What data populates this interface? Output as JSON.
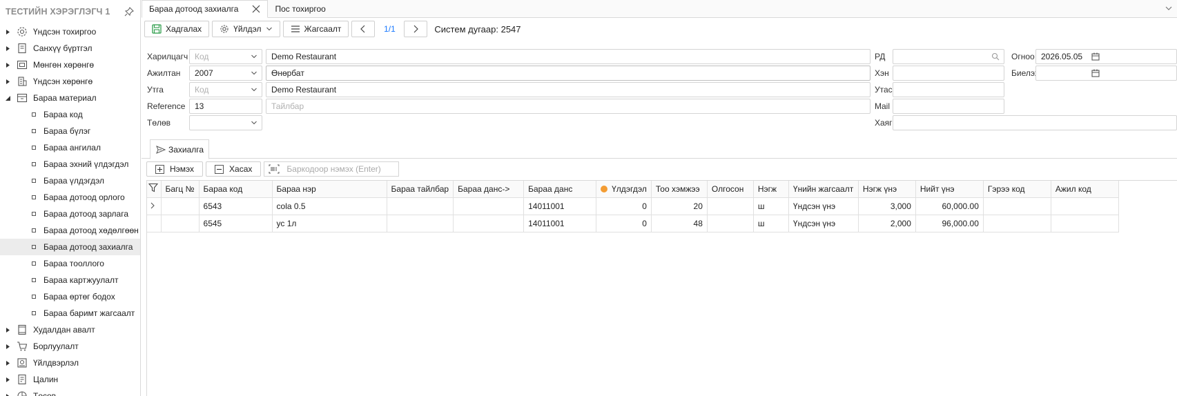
{
  "sidebar": {
    "title": "ТЕСТИЙН ХЭРЭГЛЭГЧ 1",
    "items": [
      {
        "label": "Үндсэн тохиргоо",
        "icon": "gear-icon",
        "expanded": false
      },
      {
        "label": "Санхүү бүртгэл",
        "icon": "document-icon",
        "expanded": false
      },
      {
        "label": "Мөнгөн хөрөнгө",
        "icon": "cash-icon",
        "expanded": false
      },
      {
        "label": "Үндсэн хөрөнгө",
        "icon": "building-icon",
        "expanded": false
      },
      {
        "label": "Бараа материал",
        "icon": "box-icon",
        "expanded": true
      }
    ],
    "subitems": [
      "Бараа код",
      "Бараа бүлэг",
      "Бараа ангилал",
      "Бараа эхний үлдэгдэл",
      "Бараа үлдэгдэл",
      "Бараа дотоод орлого",
      "Бараа дотоод зарлага",
      "Бараа дотоод хөдөлгөөн",
      "Бараа дотоод захиалга",
      "Бараа тооллого",
      "Бараа картжуулалт",
      "Бараа өртөг бодох",
      "Бараа баримт жагсаалт"
    ],
    "selected_subitem": "Бараа дотоод захиалга",
    "items_after": [
      {
        "label": "Худалдан авалт",
        "icon": "purchase-icon"
      },
      {
        "label": "Борлуулалт",
        "icon": "cart-icon"
      },
      {
        "label": "Үйлдвэрлэл",
        "icon": "factory-icon"
      },
      {
        "label": "Цалин",
        "icon": "payroll-icon"
      },
      {
        "label": "Төсөв",
        "icon": "pie-icon"
      }
    ]
  },
  "tabs": [
    {
      "label": "Бараа дотоод захиалга",
      "active": true
    },
    {
      "label": "Пос тохиргоо",
      "active": false
    }
  ],
  "toolbar": {
    "save_label": "Хадгалах",
    "action_label": "Үйлдэл",
    "list_label": "Жагсаалт",
    "pager": "1/1",
    "system_no": "Систем дугаар: 2547"
  },
  "form": {
    "customer_label": "Харилцагч",
    "customer_code_ph": "Код",
    "customer_name": "Demo Restaurant",
    "employee_label": "Ажилтан",
    "employee_code": "2007",
    "employee_name": "Өнөрбат",
    "warehouse_label": "Утга",
    "warehouse_code_ph": "Код",
    "warehouse_name": "Demo Restaurant",
    "reference_label": "Reference",
    "reference_value": "13",
    "description_ph": "Тайлбар",
    "status_label": "Төлөв",
    "rd_label": "РД",
    "who_label": "Хэн",
    "phone_label": "Утас",
    "mail_label": "Mail",
    "address_label": "Хаяг",
    "date_label": "Огноо",
    "date_value": "2026.05.05",
    "fulfill_label": "Биелэх"
  },
  "subtab": {
    "label": "Захиалга"
  },
  "gridbar": {
    "add_label": "Нэмэх",
    "remove_label": "Хасах",
    "barcode_ph": "Баркодоор нэмэх (Enter)"
  },
  "grid": {
    "columns": [
      "Багц №",
      "Бараа код",
      "Бараа нэр",
      "Бараа тайлбар",
      "Бараа данс->",
      "Бараа данс",
      "Үлдэгдэл",
      "Тоо хэмжээ",
      "Олгосон",
      "Нэгж",
      "Үнийн жагсаалт",
      "Нэгж үнэ",
      "Нийт үнэ",
      "Гэрээ код",
      "Ажил код"
    ],
    "rows": [
      [
        "",
        "6543",
        "cola 0.5",
        "",
        "",
        "14011001",
        "0",
        "20",
        "",
        "ш",
        "Үндсэн үнэ",
        "3,000",
        "60,000.00",
        "",
        ""
      ],
      [
        "",
        "6545",
        "ус 1л",
        "",
        "",
        "14011001",
        "0",
        "48",
        "",
        "ш",
        "Үндсэн үнэ",
        "2,000",
        "96,000.00",
        "",
        ""
      ]
    ],
    "balance_dot_color": "#f39c33"
  },
  "colors": {
    "accent": "#1677ff",
    "save_icon": "#2e9d4b"
  }
}
